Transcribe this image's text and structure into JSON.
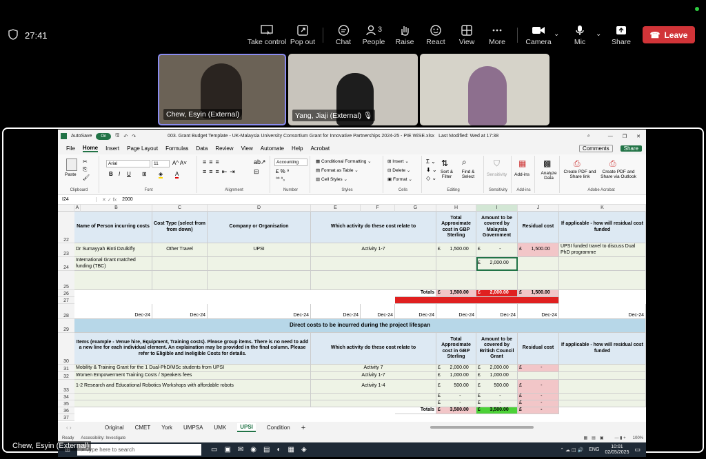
{
  "meeting": {
    "timer": "27:41",
    "buttons": [
      {
        "label": "Take control"
      },
      {
        "label": "Pop out"
      },
      {
        "label": "Chat"
      },
      {
        "label": "People",
        "count": "3"
      },
      {
        "label": "Raise"
      },
      {
        "label": "React"
      },
      {
        "label": "View"
      },
      {
        "label": "More"
      },
      {
        "label": "Camera"
      },
      {
        "label": "Mic"
      },
      {
        "label": "Share"
      }
    ],
    "leave": "Leave",
    "participants": [
      {
        "name": "Chew, Esyin (External)"
      },
      {
        "name": "Yang, Jiaji (External)"
      },
      {
        "name": ""
      }
    ],
    "bottom_name": "Chew, Esyin (External)"
  },
  "excel": {
    "autosave": "AutoSave",
    "toggle": "On",
    "filename": "003. Grant Budget Template - UK-Malaysia University Consortium Grant for Innovative Partnerships 2024-25 - PIE WiSE.xlsx",
    "modified": "Last Modified: Wed at 17:38",
    "menu": [
      "File",
      "Home",
      "Insert",
      "Page Layout",
      "Formulas",
      "Data",
      "Review",
      "View",
      "Automate",
      "Help",
      "Acrobat"
    ],
    "comments": "Comments",
    "share": "Share",
    "ribbon": {
      "paste": "Paste",
      "clipboard": "Clipboard",
      "font_name": "Arial",
      "font_size": "11",
      "font": "Font",
      "alignment": "Alignment",
      "number_format": "Accounting",
      "number": "Number",
      "cond_format": "Conditional Formatting",
      "format_table": "Format as Table",
      "cell_styles": "Cell Styles",
      "styles": "Styles",
      "insert": "Insert",
      "delete": "Delete",
      "format": "Format",
      "cells": "Cells",
      "sort_filter": "Sort & Filter",
      "find_select": "Find & Select",
      "editing": "Editing",
      "sensitivity": "Sensitivity",
      "addins": "Add-ins",
      "analyze": "Analyze Data",
      "pdf1": "Create PDF and Share link",
      "pdf2": "Create PDF and Share via Outlook",
      "acrobat": "Adobe Acrobat"
    },
    "namebox": "I24",
    "formula": "2000",
    "columns": [
      "A",
      "B",
      "C",
      "D",
      "E",
      "F",
      "G",
      "H",
      "I",
      "J",
      "K"
    ],
    "headers1": {
      "b": "Name of Person incurring costs",
      "c": "Cost Type (select from from down)",
      "d": "Company or Organisation",
      "e": "Which activity do these cost relate to",
      "h": "Total Approximate cost in GBP Sterling",
      "i": "Amount to be covered by Malaysia Government",
      "j": "Residual cost",
      "k": "If applicable - how will residual cost funded"
    },
    "row23": {
      "b": "Dr Sumayyah Binti Dzulkifly",
      "c": "Other Travel",
      "d": "UPSI",
      "e": "Activity 1-7",
      "h": "£       1,500.00",
      "i": "£              -",
      "j": "£       1,500.00",
      "k": "UPSI funded travel to discuss Dual PhD programme"
    },
    "row24": {
      "b": "International Grant matched funding (TBC)",
      "i": "£       2,000.00"
    },
    "totals1": {
      "label": "Totals",
      "h": "£       1,500.00",
      "i": "£       2,000.00",
      "j": "£       1,500.00"
    },
    "dec": "Dec-24",
    "banner": "Direct costs to be incurred during the project lifespan",
    "headers2": {
      "b": "Items (example - Venue hire, Equipment, Training costs). Please group items. There is no need to add a new line for each individual element. An explaination may be provided in the final column. Please refer to Eligible and Ineligible Costs for details.",
      "e": "Which activity do these cost relate to",
      "h": "Total Approximate cost in GBP Sterling",
      "i": "Amount to be covered by British Council Grant",
      "j": "Residual cost",
      "k": "If applicable - how will residual cost funded"
    },
    "rows2": [
      {
        "n": "31",
        "b": "Mobility & Training Grant for the 1 Dual-PhD/MSc students from UPSI",
        "e": "Activity 7",
        "h": "£       2,000.00",
        "i": "£       2,000.00",
        "j": "£              -"
      },
      {
        "n": "32",
        "b": "Women Empowerment Training Costs / Speakers fees",
        "e": "Activity 1-7",
        "h": "£       1,000.00",
        "i": "£       1,000.00",
        "j": ""
      },
      {
        "n": "33",
        "b": "1-2 Research and Educational Robotics Workshops with affordable robots",
        "e": "Activity 1-4",
        "h": "£          500.00",
        "i": "£          500.00",
        "j": "£              -"
      },
      {
        "n": "34",
        "b": "",
        "e": "",
        "h": "£              -",
        "i": "£              -",
        "j": "£              -"
      },
      {
        "n": "35",
        "b": "",
        "e": "",
        "h": "£              -",
        "i": "£              -",
        "j": "£              -"
      }
    ],
    "totals2": {
      "label": "Totals",
      "h": "£       3,500.00",
      "i": "£       3,500.00",
      "j": "£              -"
    },
    "sheets": [
      "Original",
      "CMET",
      "York",
      "UMPSA",
      "UMK",
      "UPSI",
      "Condition"
    ],
    "active_sheet": "UPSI",
    "status": {
      "ready": "Ready",
      "access": "Accessibility: Investigate",
      "zoom": "100%"
    }
  },
  "taskbar": {
    "search": "Type here to search",
    "lang": "ENG",
    "time": "10:01",
    "date": "02/05/2025"
  }
}
